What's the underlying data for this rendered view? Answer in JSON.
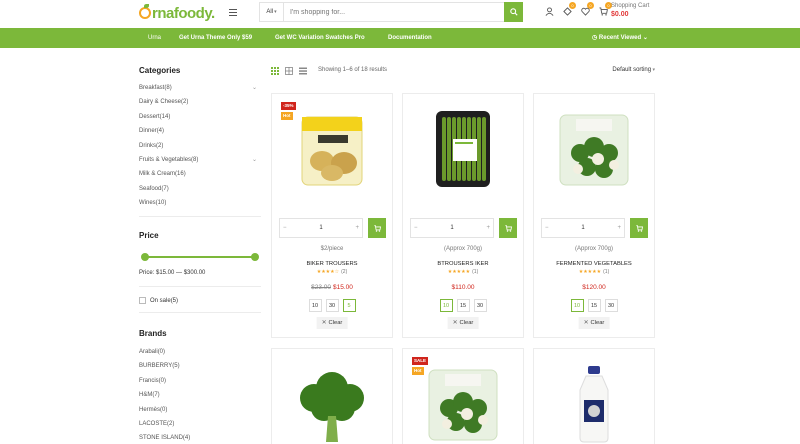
{
  "header": {
    "logo_prefix": "u",
    "logo_text": "rnafoody.",
    "search_category": "All",
    "search_placeholder": "I'm shopping for...",
    "compare_count": "0",
    "wishlist_count": "0",
    "cart_count": "0",
    "cart_label": "Shopping Cart",
    "cart_total": "$0.00"
  },
  "nav": {
    "items": [
      "Urna",
      "Get Urna Theme Only $59",
      "Get WC Variation Swatches Pro",
      "Documentation"
    ],
    "recent": "Recent Viewed"
  },
  "sidebar": {
    "categories_title": "Categories",
    "categories": [
      {
        "label": "Breakfast",
        "count": "(8)",
        "chev": "⌄"
      },
      {
        "label": "Dairy & Cheese",
        "count": "(2)",
        "chev": ""
      },
      {
        "label": "Dessert",
        "count": "(14)",
        "chev": ""
      },
      {
        "label": "Dinner",
        "count": "(4)",
        "chev": ""
      },
      {
        "label": "Drinks",
        "count": "(2)",
        "chev": ""
      },
      {
        "label": "Fruits & Vegetables",
        "count": "(8)",
        "chev": "⌄"
      },
      {
        "label": "Milk & Cream",
        "count": "(16)",
        "chev": ""
      },
      {
        "label": "Seafood",
        "count": "(7)",
        "chev": ""
      },
      {
        "label": "Wines",
        "count": "(10)",
        "chev": ""
      }
    ],
    "price_title": "Price",
    "price_range": "Price: $15.00 — $300.00",
    "on_sale_label": "On sale",
    "on_sale_count": "(5)",
    "brands_title": "Brands",
    "brands": [
      {
        "label": "Arabali",
        "count": "(0)"
      },
      {
        "label": "BURBERRY",
        "count": "(5)"
      },
      {
        "label": "Francis",
        "count": "(0)"
      },
      {
        "label": "H&M",
        "count": "(7)"
      },
      {
        "label": "Hermès",
        "count": "(0)"
      },
      {
        "label": "LACOSTE",
        "count": "(2)"
      },
      {
        "label": "STONE ISLAND",
        "count": "(4)"
      }
    ]
  },
  "toolbar": {
    "showing": "Showing 1–6 of 18 results",
    "sort": "Default sorting"
  },
  "products": [
    {
      "sale_tag": "-35%",
      "hot_tag": "Hot",
      "unit": "$2/piece",
      "name": "BIKER TROUSERS",
      "stars": "★★★★☆",
      "reviews": "(2)",
      "old_price": "$23.00",
      "price": "$15.00",
      "qty": "1",
      "swatches": [
        "10",
        "30",
        "5"
      ],
      "selected": 2,
      "clear": "Clear",
      "image": "potatoes-bag"
    },
    {
      "sale_tag": "",
      "hot_tag": "",
      "unit": "(Approx 700g)",
      "name": "BTROUSERS IKER",
      "stars": "★★★★★",
      "reviews": "(1)",
      "old_price": "",
      "price": "$110.00",
      "qty": "1",
      "swatches": [
        "10",
        "15",
        "30"
      ],
      "selected": 0,
      "clear": "Clear",
      "image": "asparagus-tray"
    },
    {
      "sale_tag": "",
      "hot_tag": "",
      "unit": "(Approx 700g)",
      "name": "FERMENTED VEGETABLES",
      "stars": "★★★★★",
      "reviews": "(1)",
      "old_price": "",
      "price": "$120.00",
      "qty": "1",
      "swatches": [
        "10",
        "15",
        "30"
      ],
      "selected": 0,
      "clear": "Clear",
      "image": "broccoli-bag"
    },
    {
      "sale_tag": "",
      "hot_tag": "",
      "image": "broccoli-head"
    },
    {
      "sale_tag": "SALE",
      "hot_tag": "Hot",
      "image": "broccoli-bag"
    },
    {
      "sale_tag": "",
      "hot_tag": "",
      "image": "milk-bottle"
    }
  ],
  "colors": {
    "accent": "#7cb83a",
    "orange": "#f5a623",
    "sale": "#d0251c"
  }
}
